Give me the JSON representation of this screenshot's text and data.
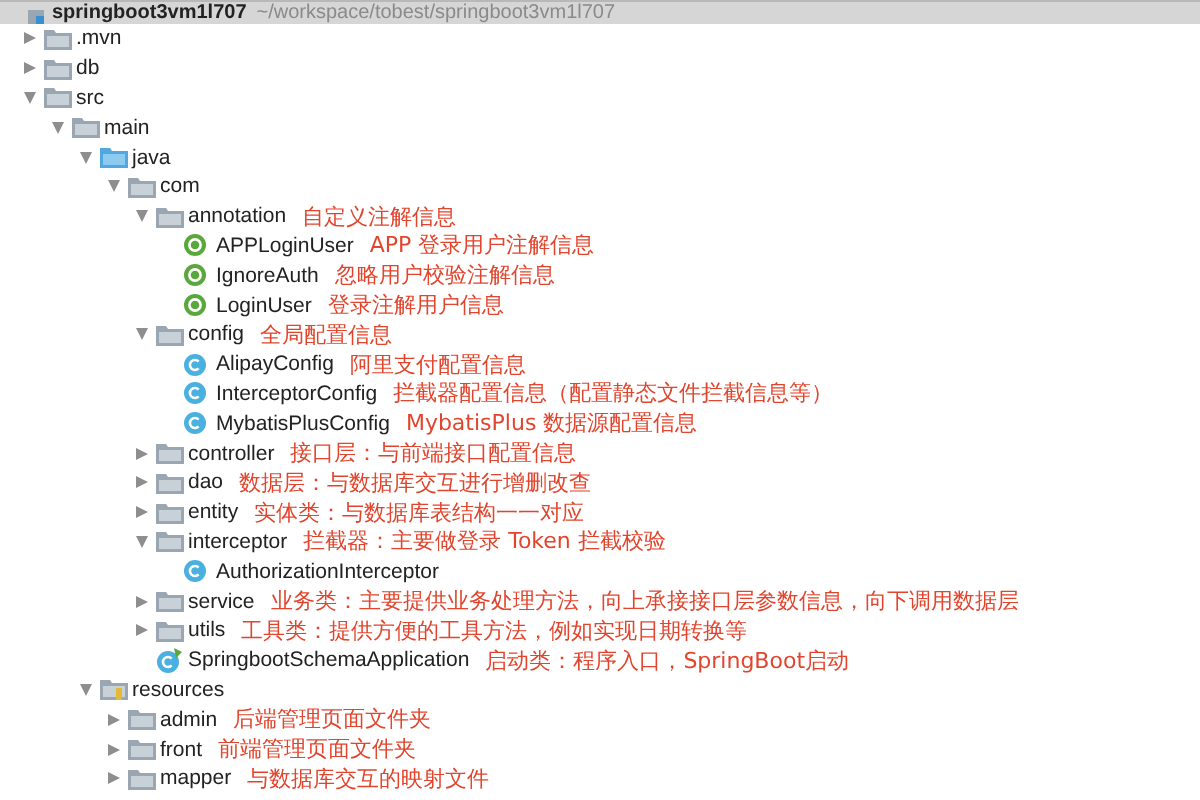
{
  "project": {
    "name": "springboot3vm1l707",
    "path": "~/workspace/tobest/springboot3vm1l707"
  },
  "tree": [
    {
      "name": ".mvn",
      "kind": "folder",
      "expanded": false
    },
    {
      "name": "db",
      "kind": "folder",
      "expanded": false
    },
    {
      "name": "src",
      "kind": "folder",
      "expanded": true,
      "children": [
        {
          "name": "main",
          "kind": "folder",
          "expanded": true,
          "children": [
            {
              "name": "java",
              "kind": "source_folder",
              "expanded": true,
              "children": [
                {
                  "name": "com",
                  "kind": "folder",
                  "expanded": true,
                  "children": [
                    {
                      "name": "annotation",
                      "kind": "folder",
                      "expanded": true,
                      "comment": "自定义注解信息",
                      "children": [
                        {
                          "name": "APPLoginUser",
                          "kind": "annotation",
                          "comment": "APP 登录用户注解信息"
                        },
                        {
                          "name": "IgnoreAuth",
                          "kind": "annotation",
                          "comment": "忽略用户校验注解信息"
                        },
                        {
                          "name": "LoginUser",
                          "kind": "annotation",
                          "comment": "登录注解用户信息"
                        }
                      ]
                    },
                    {
                      "name": "config",
                      "kind": "folder",
                      "expanded": true,
                      "comment": "全局配置信息",
                      "children": [
                        {
                          "name": "AlipayConfig",
                          "kind": "class",
                          "comment": "阿里支付配置信息"
                        },
                        {
                          "name": "InterceptorConfig",
                          "kind": "class",
                          "comment": "拦截器配置信息（配置静态文件拦截信息等）"
                        },
                        {
                          "name": "MybatisPlusConfig",
                          "kind": "class",
                          "comment": "MybatisPlus 数据源配置信息"
                        }
                      ]
                    },
                    {
                      "name": "controller",
                      "kind": "folder",
                      "expanded": false,
                      "comment": "接口层：与前端接口配置信息"
                    },
                    {
                      "name": "dao",
                      "kind": "folder",
                      "expanded": false,
                      "comment": "数据层：与数据库交互进行增删改查"
                    },
                    {
                      "name": "entity",
                      "kind": "folder",
                      "expanded": false,
                      "comment": "实体类：与数据库表结构一一对应"
                    },
                    {
                      "name": "interceptor",
                      "kind": "folder",
                      "expanded": true,
                      "comment": "拦截器：主要做登录 Token 拦截校验",
                      "children": [
                        {
                          "name": "AuthorizationInterceptor",
                          "kind": "class"
                        }
                      ]
                    },
                    {
                      "name": "service",
                      "kind": "folder",
                      "expanded": false,
                      "comment": "业务类：主要提供业务处理方法，向上承接接口层参数信息，向下调用数据层"
                    },
                    {
                      "name": "utils",
                      "kind": "folder",
                      "expanded": false,
                      "comment": "工具类：提供方便的工具方法，例如实现日期转换等"
                    },
                    {
                      "name": "SpringbootSchemaApplication",
                      "kind": "spring_class",
                      "comment": "启动类：程序入口，SpringBoot启动"
                    }
                  ]
                }
              ]
            },
            {
              "name": "resources",
              "kind": "resources_folder",
              "expanded": true,
              "children": [
                {
                  "name": "admin",
                  "kind": "folder",
                  "expanded": false,
                  "comment": "后端管理页面文件夹"
                },
                {
                  "name": "front",
                  "kind": "folder",
                  "expanded": false,
                  "comment": "前端管理页面文件夹"
                },
                {
                  "name": "mapper",
                  "kind": "folder",
                  "expanded": false,
                  "comment": "与数据库交互的映射文件"
                }
              ]
            }
          ]
        }
      ]
    }
  ]
}
